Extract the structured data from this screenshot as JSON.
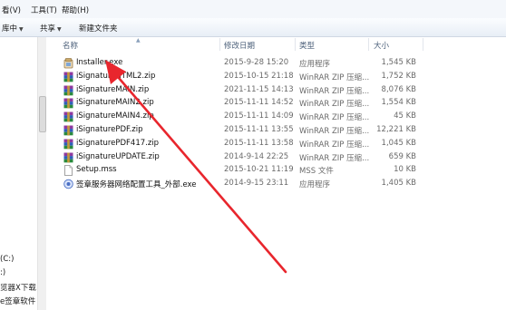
{
  "menubar": {
    "items": [
      "看(V)",
      "工具(T)",
      "帮助(H)"
    ]
  },
  "toolbar": {
    "items": [
      "库中",
      "共享",
      "新建文件夹"
    ]
  },
  "list": {
    "headers": [
      "名称",
      "修改日期",
      "类型",
      "大小"
    ],
    "rows": [
      {
        "name": "Installer.exe",
        "date": "2015-9-28 15:20",
        "type": "应用程序",
        "size": "1,545 KB",
        "icon": "installer-icon"
      },
      {
        "name": "iSignatureHTML2.zip",
        "date": "2015-10-15 21:18",
        "type": "WinRAR ZIP 压缩...",
        "size": "1,752 KB",
        "icon": "winrar-zip-icon"
      },
      {
        "name": "iSignatureMAIN.zip",
        "date": "2021-11-15 14:13",
        "type": "WinRAR ZIP 压缩...",
        "size": "8,076 KB",
        "icon": "winrar-zip-icon"
      },
      {
        "name": "iSignatureMAIN2.zip",
        "date": "2015-11-11 14:52",
        "type": "WinRAR ZIP 压缩...",
        "size": "1,554 KB",
        "icon": "winrar-zip-icon"
      },
      {
        "name": "iSignatureMAIN4.zip",
        "date": "2015-11-11 14:09",
        "type": "WinRAR ZIP 压缩...",
        "size": "45 KB",
        "icon": "winrar-zip-icon"
      },
      {
        "name": "iSignaturePDF.zip",
        "date": "2015-11-11 13:55",
        "type": "WinRAR ZIP 压缩...",
        "size": "12,221 KB",
        "icon": "winrar-zip-icon"
      },
      {
        "name": "iSignaturePDF417.zip",
        "date": "2015-11-11 13:58",
        "type": "WinRAR ZIP 压缩...",
        "size": "1,045 KB",
        "icon": "winrar-zip-icon"
      },
      {
        "name": "iSignatureUPDATE.zip",
        "date": "2014-9-14 22:25",
        "type": "WinRAR ZIP 压缩...",
        "size": "659 KB",
        "icon": "winrar-zip-icon"
      },
      {
        "name": "Setup.mss",
        "date": "2015-10-21 11:19",
        "type": "MSS 文件",
        "size": "10 KB",
        "icon": "document-icon"
      },
      {
        "name": "签章服务器网络配置工具_外部.exe",
        "date": "2014-9-15 23:11",
        "type": "应用程序",
        "size": "1,405 KB",
        "icon": "config-tool-icon"
      }
    ]
  },
  "sidebar": {
    "items": [
      "(C:)",
      ":)",
      "览器X下载",
      "e签章软件"
    ]
  },
  "annotation": {
    "color": "#e8262d"
  }
}
